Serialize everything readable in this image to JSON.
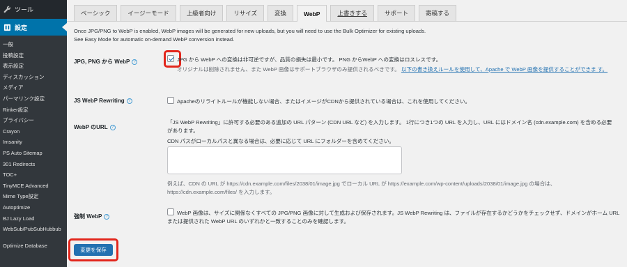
{
  "sidebar": {
    "tools": {
      "label": "ツール",
      "icon": "wrench-icon"
    },
    "settings": {
      "label": "設定",
      "icon": "settings-icon"
    },
    "items": [
      {
        "label": "一般"
      },
      {
        "label": "投稿設定"
      },
      {
        "label": "表示設定"
      },
      {
        "label": "ディスカッション"
      },
      {
        "label": "メディア"
      },
      {
        "label": "パーマリンク設定"
      },
      {
        "label": "Rinker設定"
      },
      {
        "label": "プライバシー"
      },
      {
        "label": "Crayon"
      },
      {
        "label": "Imsanity"
      },
      {
        "label": "PS Auto Sitemap"
      },
      {
        "label": "301 Redirects"
      },
      {
        "label": "TOC+"
      },
      {
        "label": "TinyMCE Advanced"
      },
      {
        "label": "Mime Type設定"
      },
      {
        "label": "Autoptimize"
      },
      {
        "label": "BJ Lazy Load"
      },
      {
        "label": "WebSub/PubSubHubbub"
      },
      {
        "label": "Optimize Database"
      }
    ]
  },
  "tabs": [
    {
      "label": "ベーシック"
    },
    {
      "label": "イージーモード"
    },
    {
      "label": "上級者向け"
    },
    {
      "label": "リサイズ"
    },
    {
      "label": "変換"
    },
    {
      "label": "WebP",
      "active": true
    },
    {
      "label": "上書きする"
    },
    {
      "label": "サポート"
    },
    {
      "label": "寄稿する"
    }
  ],
  "notice": {
    "line1": "Once JPG/PNG to WebP is enabled, WebP images will be generated for new uploads, but you will need to use the Bulk Optimizer for existing uploads.",
    "line2": "See Easy Mode for automatic on-demand WebP conversion instead."
  },
  "jpg_png_webp": {
    "label": "JPG, PNG から WebP",
    "checked": true,
    "line1": "JPG から WebP への変換は非可逆ですが、品質の損失は最小です。 PNG からWebP への変換はロスレスです。",
    "line2": "オリジナルは削除されません、また WebP 画像はサポートブラウザのみ提供されるべきです。",
    "link": "以下の書き換えルールを使用して、Apache で WebP 画像を提供することができま す。"
  },
  "js_webp": {
    "label": "JS WebP Rewriting",
    "checked": false,
    "text": "Apacheのリライトルールが機能しない場合、またはイメージがCDNから提供されている場合は、これを使用してください。"
  },
  "webp_url": {
    "label": "WebP のURL",
    "desc1": "「JS WebP Rewriting」に許可する必要のある追加の URL パターン (CDN URL など) を入力します。 1行につき1つの URL を入力し、URL にはドメイン名 (cdn.example.com) を含める必要があります。",
    "desc2": "CDN パスがローカルパスと異なる場合は、必要に応じて URL にフォルダーを含めてください。",
    "textarea_value": "",
    "example": "例えば、CDN の URL が https://cdn.example.com/files/2038/01/image.jpg でローカル URL が https://example.com/wp-content/uploads/2038/01/image.jpg の場合は、https://cdn.example.com/files/ を入力します。"
  },
  "force_webp": {
    "label": "強制 WebP",
    "checked": false,
    "text": "WebP 画像は、サイズに関係なくすべての JPG/PNG 画像に対して生成および保存されます。JS WebP Rewriting は、ファイルが存在するかどうかをチェックせず、ドメインがホーム URL または提供された WebP URL のいずれかと一致することのみを確認します。"
  },
  "save_button": {
    "label": "変更を保存"
  },
  "colors": {
    "sidebar": "#23282d",
    "sidebar_sub": "#32373c",
    "accent": "#0073aa",
    "button": "#2271b1",
    "highlight": "#e2261c"
  }
}
